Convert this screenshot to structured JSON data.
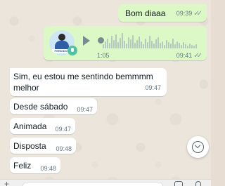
{
  "colors": {
    "outgoing_bubble": "#dcf8c6",
    "incoming_bubble": "#ffffff",
    "chat_background": "#ece5dc",
    "meta_text": "#667781"
  },
  "messages": {
    "out_text": {
      "text": "Bom diaaa",
      "time": "09:39"
    },
    "voice": {
      "duration": "1:05",
      "time": "09:41",
      "avatar_tag": "PERDIDOS",
      "icon": "microphone-icon"
    },
    "in": [
      {
        "text": "Sim, eu estou me sentindo bemmmm melhor",
        "time": "09:47"
      },
      {
        "text": "Desde sábado",
        "time": "09:47"
      },
      {
        "text": "Animada",
        "time": "09:47"
      },
      {
        "text": "Disposta",
        "time": "09:48"
      },
      {
        "text": "Feliz",
        "time": "09:48"
      }
    ]
  },
  "scroll_button": {
    "icon": "chevron-down-icon"
  },
  "input_bar": {
    "plus_icon": "+",
    "icons": [
      "plus-icon",
      "camera-icon",
      "microphone-icon"
    ]
  }
}
